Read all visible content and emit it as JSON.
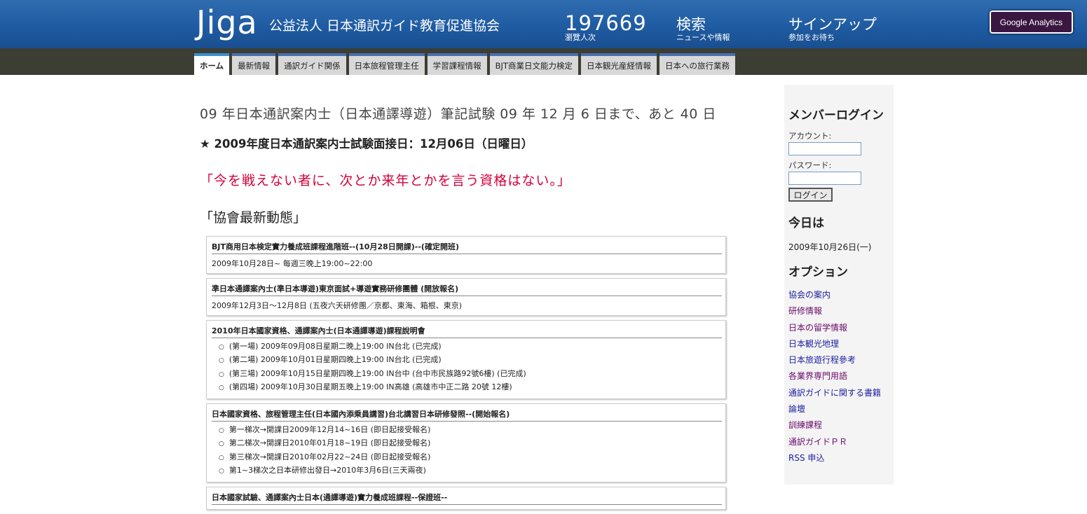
{
  "header": {
    "logo": "Jiga",
    "org_name": "公益法人 日本通訳ガイド教育促進協会",
    "counter_value": "197669",
    "counter_label": "瀏覽人次",
    "search_label": "検索",
    "search_sub": "ニュースや情報",
    "signup_label": "サインアップ",
    "signup_sub": "参加をお待ち",
    "ga_button": "Google Analytics"
  },
  "tabs": [
    {
      "label": "ホーム",
      "active": true
    },
    {
      "label": "最新情報"
    },
    {
      "label": "通訳ガイド関係"
    },
    {
      "label": "日本旅程管理主任"
    },
    {
      "label": "学習課程情報"
    },
    {
      "label": "BJT商業日文能力検定"
    },
    {
      "label": "日本観光産経情報"
    },
    {
      "label": "日本への旅行業務"
    }
  ],
  "main": {
    "headline": "09 年日本通訳案内士（日本通譯導遊）筆記試験 09 年 12 月 6 日まで、あと 40 日",
    "star_line": "★ 2009年度日本通訳案内士試験面接日：12月06日（日曜日）",
    "quote": "「今を戦えない者に、次とか来年とかを言う資格はない。」",
    "section_title": "「協會最新動態」",
    "boxes": [
      {
        "title": "BJT商用日本検定實力養成班課程進階班--(10月28日開課)--(確定開班)",
        "body": "2009年10月28日~ 每週三晚上19:00~22:00"
      },
      {
        "title": "準日本通譯案內士(準日本導遊)東京面試+導遊實務研修團體 (開放報名)",
        "body": "2009年12月3日～12月8日 (五夜六天研修團／京都、東海、箱根、東京)"
      },
      {
        "title": "2010年日本國家資格、通譯案內士(日本通譯導遊)課程說明會",
        "items": [
          "(第一場) 2009年09月08日星期二晚上19:00 IN台北 (已完成)",
          "(第二場) 2009年10月01日星期四晚上19:00 IN台北 (已完成)",
          "(第三場) 2009年10月15日星期四晚上19:00 IN台中 (台中市民族路92號6樓) (已完成)",
          "(第四場) 2009年10月30日星期五晚上19:00 IN高雄 (高雄市中正二路 20號 12樓)"
        ]
      },
      {
        "title": "日本國家資格、旅程管理主任(日本國內添乘員講習)台北講習日本研修發照--(開始報名)",
        "items": [
          "第一梯次→開課日2009年12月14~16日 (即日起接受報名)",
          "第二梯次→開課日2010年01月18~19日 (即日起接受報名)",
          "第三梯次→開課日2010年02月22~24日 (即日起接受報名)",
          "第1~3梯次之日本研修出發日→2010年3月6日(三天兩夜)"
        ]
      },
      {
        "title": "日本國家試驗、通譯案內士日本(通譯導遊)實力養成班課程--保證班--"
      }
    ]
  },
  "sidebar": {
    "login_title": "メンバーログイン",
    "account_label": "アカウント:",
    "password_label": "パスワード:",
    "login_button": "ログイン",
    "today_title": "今日は",
    "today_date": "2009年10月26日(一)",
    "options_title": "オプション",
    "links": [
      {
        "label": "協会の案内",
        "visited": false
      },
      {
        "label": "研修情報",
        "visited": true
      },
      {
        "label": "日本の留学情報",
        "visited": true
      },
      {
        "label": "日本観光地理",
        "visited": false
      },
      {
        "label": "日本旅遊行程參考",
        "visited": false
      },
      {
        "label": "各業界専門用語",
        "visited": true
      },
      {
        "label": "通訳ガイドに関する書籍",
        "visited": false
      },
      {
        "label": "論壇",
        "visited": false
      },
      {
        "label": "訓練課程",
        "visited": true
      },
      {
        "label": "通訳ガイドＰＲ",
        "visited": true
      },
      {
        "label": "RSS 申込",
        "visited": false
      }
    ]
  }
}
